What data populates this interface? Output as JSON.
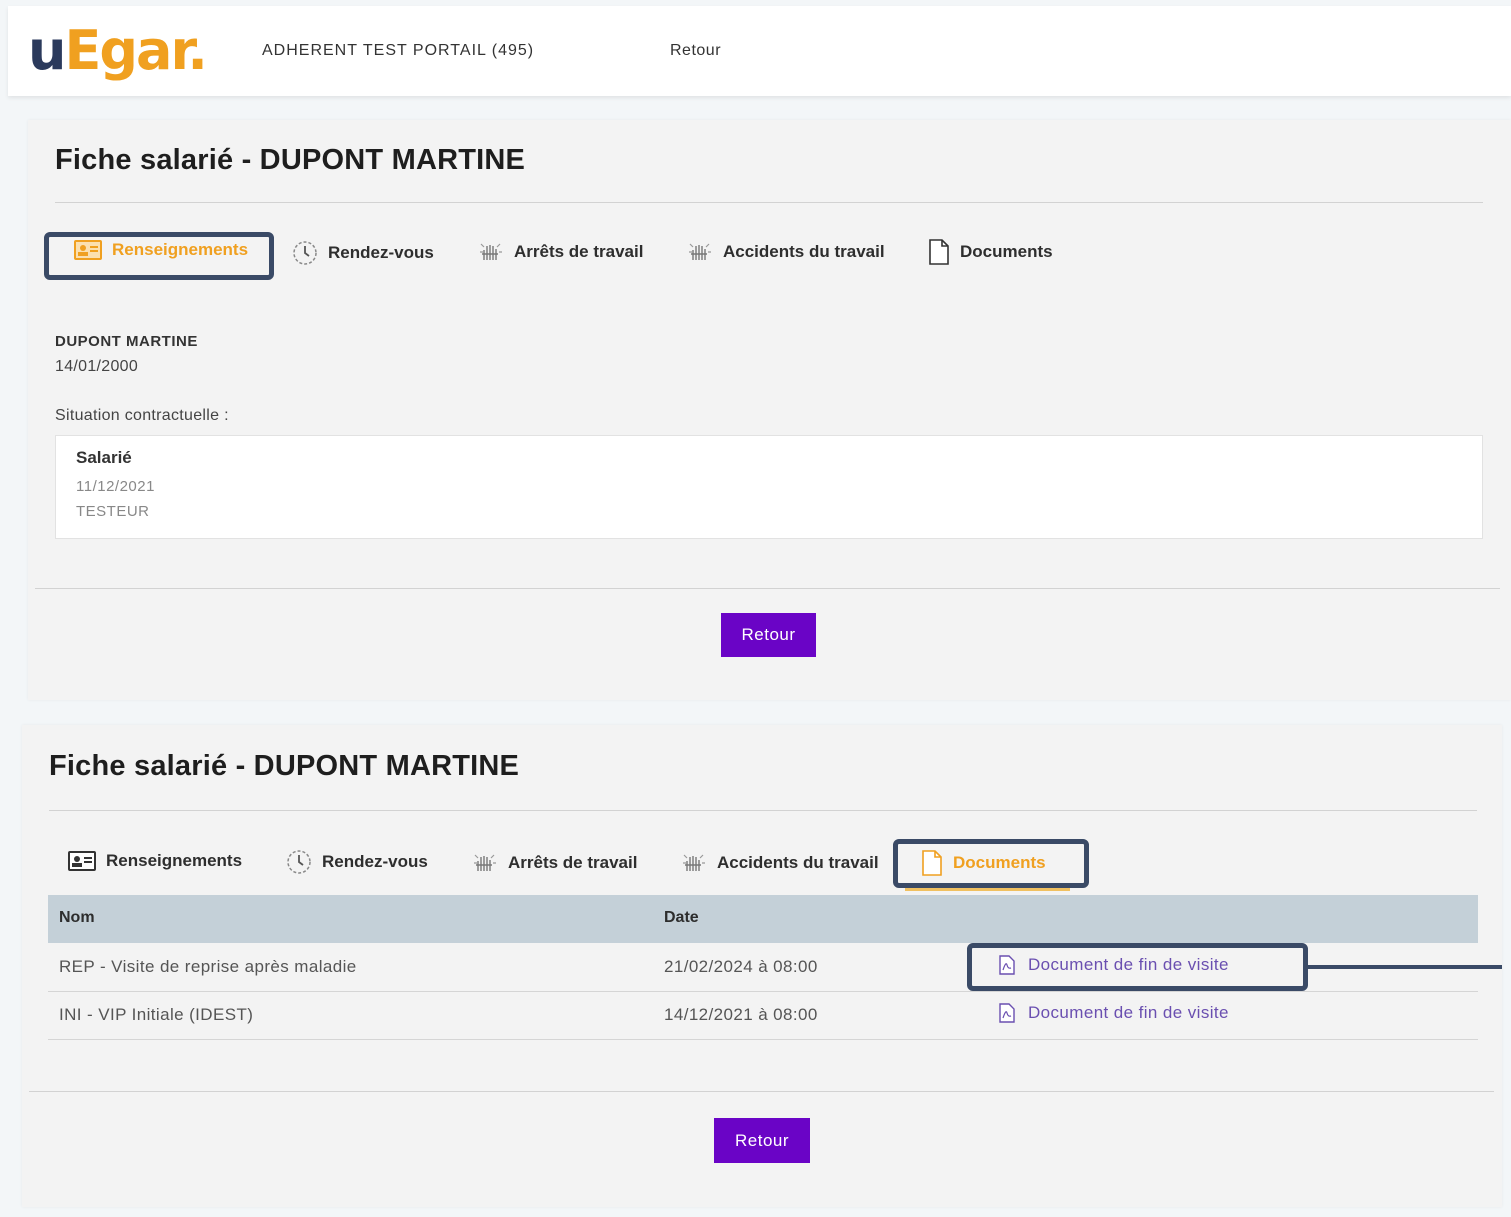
{
  "header": {
    "logo_text": "uEgar.",
    "logo_part_u": "u",
    "logo_part_e": "E",
    "logo_part_rest": "gar.",
    "company": "ADHERENT TEST PORTAIL (495)",
    "retour_link": "Retour"
  },
  "screen1": {
    "title": "Fiche salarié - DUPONT MARTINE",
    "tabs": [
      {
        "label": "Renseignements",
        "icon": "id-card-icon",
        "active": true
      },
      {
        "label": "Rendez-vous",
        "icon": "clock-icon",
        "active": false
      },
      {
        "label": "Arrêts de travail",
        "icon": "hand-icon",
        "active": false
      },
      {
        "label": "Accidents du travail",
        "icon": "hand-icon",
        "active": false
      },
      {
        "label": "Documents",
        "icon": "document-icon",
        "active": false
      }
    ],
    "employee_name": "DUPONT MARTINE",
    "birth_date": "14/01/2000",
    "situation_label": "Situation contractuelle :",
    "contract": {
      "type": "Salarié",
      "date": "11/12/2021",
      "role": "TESTEUR"
    },
    "retour_button": "Retour"
  },
  "screen2": {
    "title": "Fiche salarié - DUPONT MARTINE",
    "tabs": [
      {
        "label": "Renseignements",
        "icon": "id-card-icon",
        "active": false
      },
      {
        "label": "Rendez-vous",
        "icon": "clock-icon",
        "active": false
      },
      {
        "label": "Arrêts de travail",
        "icon": "hand-icon",
        "active": false
      },
      {
        "label": "Accidents du travail",
        "icon": "hand-icon",
        "active": false
      },
      {
        "label": "Documents",
        "icon": "document-icon",
        "active": true
      }
    ],
    "table": {
      "columns": [
        "Nom",
        "Date"
      ],
      "rows": [
        {
          "nom": "REP - Visite de reprise après maladie",
          "date": "21/02/2024 à 08:00",
          "link": "Document de fin de visite"
        },
        {
          "nom": "INI - VIP Initiale (IDEST)",
          "date": "14/12/2021 à 08:00",
          "link": "Document de fin de visite"
        }
      ]
    },
    "retour_button": "Retour"
  },
  "colors": {
    "accent": "#f0a020",
    "primary_button": "#6a04c6",
    "highlight_box": "#3a4a66",
    "table_header": "#c4d0d8",
    "link": "#6a4fb0"
  }
}
